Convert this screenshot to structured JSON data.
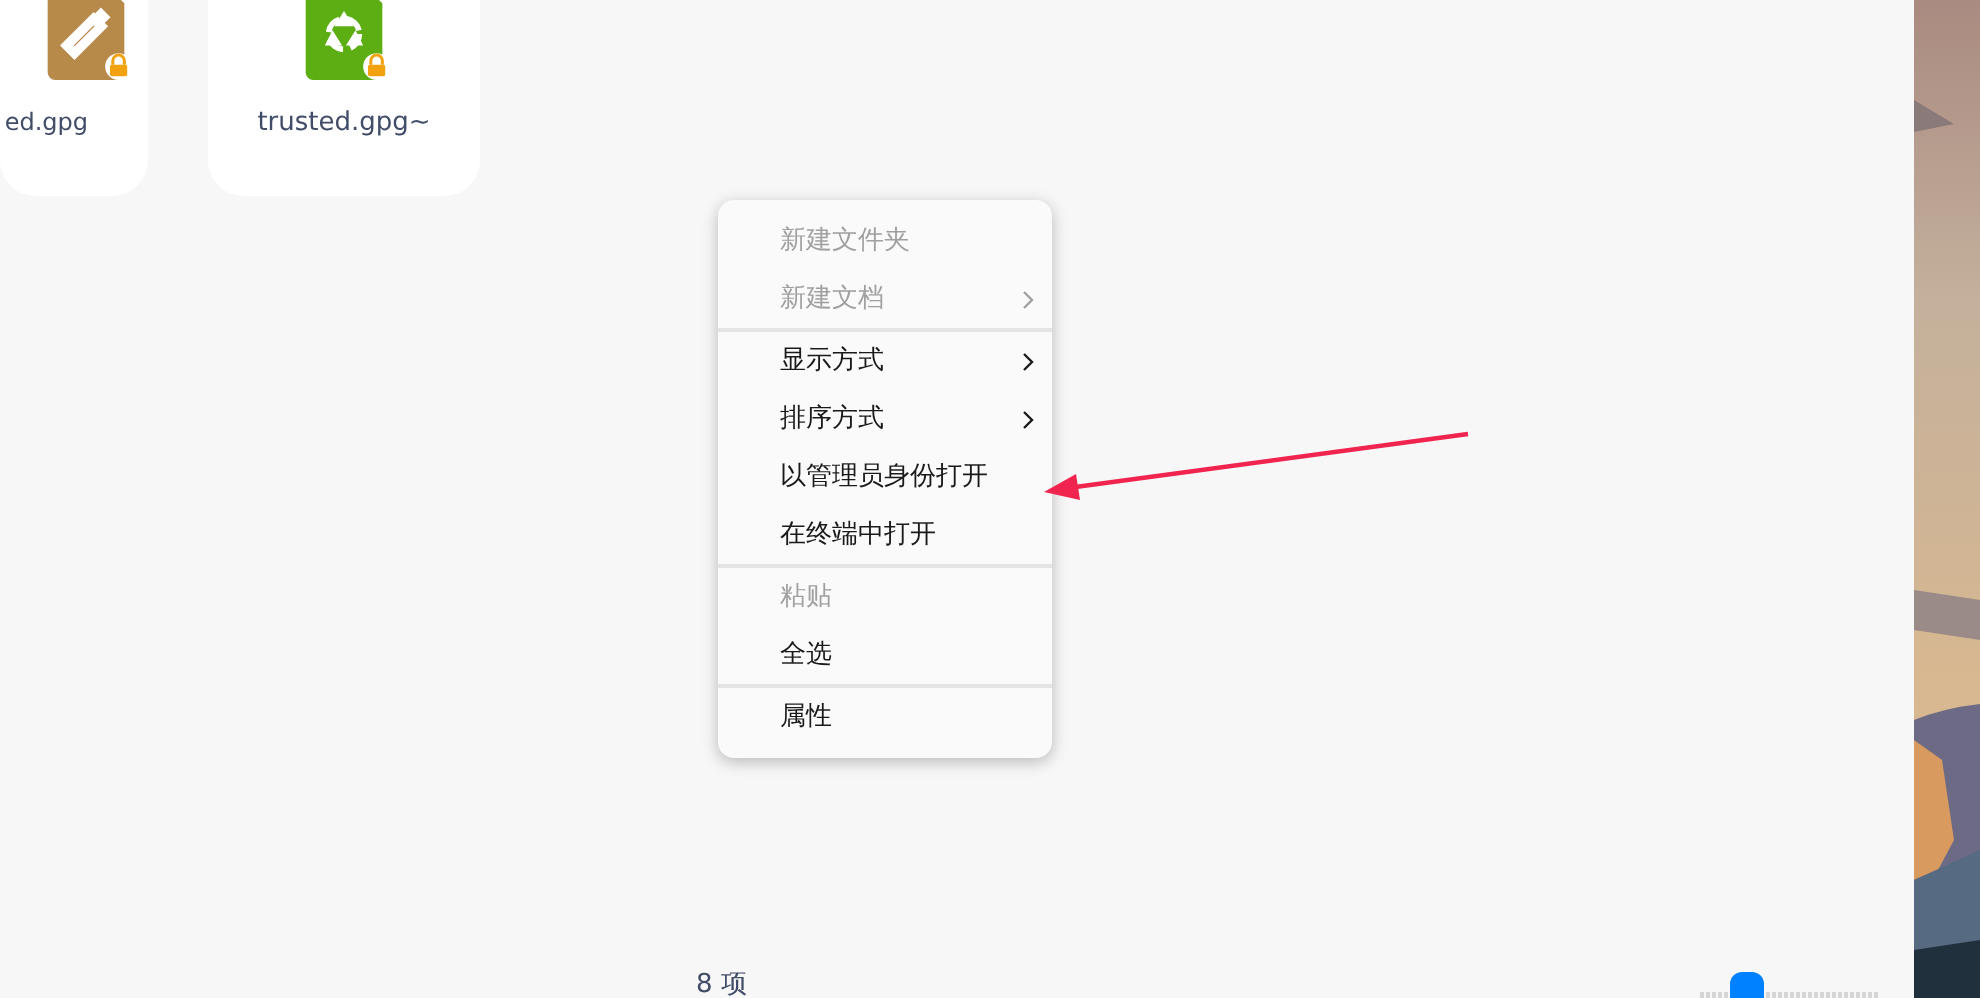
{
  "files": [
    {
      "name": "ed.gpg",
      "kind": "key",
      "locked": true
    },
    {
      "name": "trusted.gpg~",
      "kind": "recycle",
      "locked": true
    }
  ],
  "context_menu": {
    "groups": [
      [
        {
          "label": "新建文件夹",
          "disabled": true,
          "submenu": false
        },
        {
          "label": "新建文档",
          "disabled": true,
          "submenu": true
        }
      ],
      [
        {
          "label": "显示方式",
          "disabled": false,
          "submenu": true
        },
        {
          "label": "排序方式",
          "disabled": false,
          "submenu": true
        },
        {
          "label": "以管理员身份打开",
          "disabled": false,
          "submenu": false
        },
        {
          "label": "在终端中打开",
          "disabled": false,
          "submenu": false
        }
      ],
      [
        {
          "label": "粘贴",
          "disabled": true,
          "submenu": false
        },
        {
          "label": "全选",
          "disabled": false,
          "submenu": false
        }
      ],
      [
        {
          "label": "属性",
          "disabled": false,
          "submenu": false
        }
      ]
    ]
  },
  "status_bar": {
    "item_count": "8 项",
    "zoom_slider": {
      "level": 0.25
    }
  }
}
